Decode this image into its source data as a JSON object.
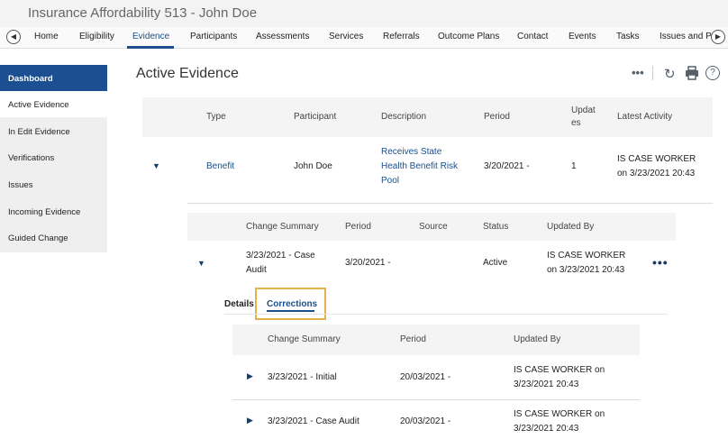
{
  "app": {
    "title": "Insurance Affordability 513 - John Doe"
  },
  "nav": {
    "tabs": [
      "Home",
      "Eligibility",
      "Evidence",
      "Participants",
      "Assessments",
      "Services",
      "Referrals",
      "Outcome Plans",
      "Contact",
      "Events",
      "Tasks",
      "Issues and P"
    ],
    "active": "Evidence"
  },
  "sidebar": {
    "items": [
      "Dashboard",
      "Active Evidence",
      "In Edit Evidence",
      "Verifications",
      "Issues",
      "Incoming Evidence",
      "Guided Change"
    ]
  },
  "page": {
    "title": "Active Evidence"
  },
  "evidence_table": {
    "columns": [
      "Type",
      "Participant",
      "Description",
      "Period",
      "Updates",
      "Latest Activity"
    ],
    "columns_wrapped": {
      "updates_line1": "Updat",
      "updates_line2": "es"
    },
    "row": {
      "type": "Benefit",
      "participant": "John Doe",
      "description": [
        "Receives State",
        "Health Benefit Risk",
        "Pool"
      ],
      "period": "3/20/2021 -",
      "updates": "1",
      "latest_activity": [
        "IS CASE WORKER",
        "on 3/23/2021 20:43"
      ]
    }
  },
  "change_table": {
    "columns": [
      "Change Summary",
      "Period",
      "Source",
      "Status",
      "Updated By"
    ],
    "row": {
      "change_summary": [
        "3/23/2021 - Case",
        "Audit"
      ],
      "period": "3/20/2021 -",
      "source": "",
      "status": "Active",
      "updated_by": [
        "IS CASE WORKER",
        "on 3/23/2021 20:43"
      ]
    }
  },
  "detail_tabs": {
    "details": "Details",
    "corrections": "Corrections",
    "active": "Corrections"
  },
  "corrections_table": {
    "columns": [
      "Change Summary",
      "Period",
      "Updated By"
    ],
    "rows": [
      {
        "change_summary": "3/23/2021 - Initial",
        "period": "20/03/2021 -",
        "updated_by": [
          "IS CASE WORKER on",
          "3/23/2021 20:43"
        ]
      },
      {
        "change_summary": "3/23/2021 - Case Audit",
        "period": "20/03/2021 -",
        "updated_by": [
          "IS CASE WORKER on",
          "3/23/2021 20:43"
        ]
      }
    ]
  },
  "icons": {
    "more": "ellipsis-icon",
    "refresh": "refresh-icon",
    "print": "print-icon",
    "help": "help-icon",
    "expand": "caret-down-icon",
    "collapse": "caret-right-icon"
  },
  "colors": {
    "accent": "#1a4f8b",
    "sidebar_active": "#1c4f91",
    "highlight": "#e3b24b"
  }
}
